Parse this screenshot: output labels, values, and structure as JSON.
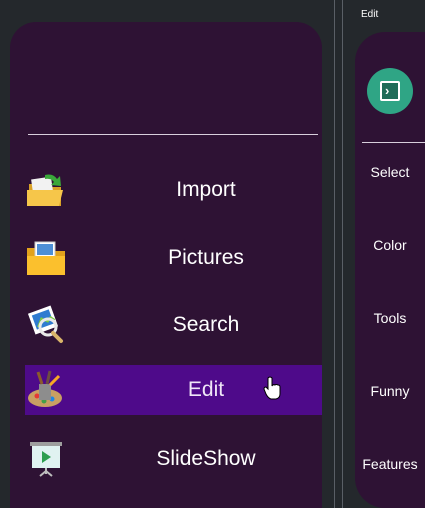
{
  "menu": {
    "items": [
      {
        "label": "Import",
        "icon": "folder-import-icon"
      },
      {
        "label": "Pictures",
        "icon": "pictures-folder-icon"
      },
      {
        "label": "Search",
        "icon": "photo-search-icon"
      },
      {
        "label": "Edit",
        "icon": "edit-brushes-icon",
        "active": true
      },
      {
        "label": "SlideShow",
        "icon": "slideshow-icon"
      }
    ]
  },
  "edit_panel": {
    "title": "Edit",
    "toggle_icon": "chevron-right-icon",
    "items": [
      {
        "label": "Select"
      },
      {
        "label": "Color"
      },
      {
        "label": "Tools"
      },
      {
        "label": "Funny"
      },
      {
        "label": "Features"
      }
    ]
  },
  "colors": {
    "panel_bg": "#2e1234",
    "active_item": "#4e0a8a",
    "accent": "#2fa585"
  }
}
